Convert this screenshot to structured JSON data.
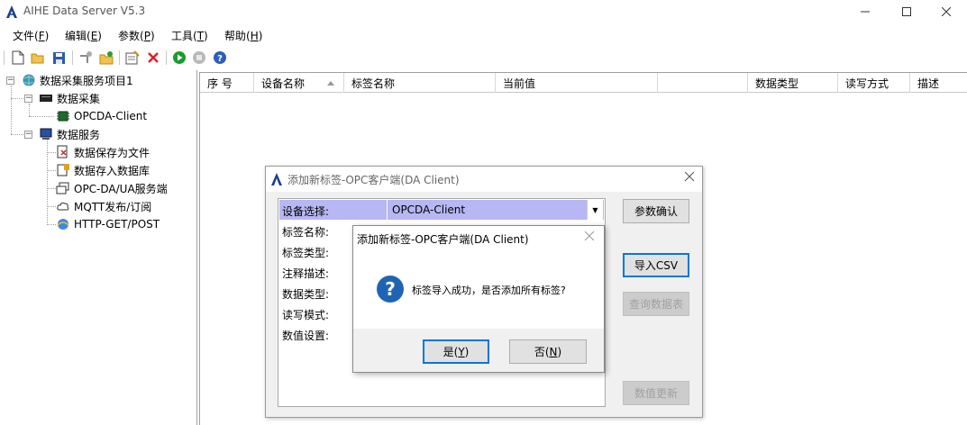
{
  "window": {
    "title": "AIHE Data Server V5.3"
  },
  "menu": [
    {
      "label": "文件(",
      "key": "F",
      "end": ")"
    },
    {
      "label": "编辑(",
      "key": "E",
      "end": ")"
    },
    {
      "label": "参数(",
      "key": "P",
      "end": ")"
    },
    {
      "label": "工具(",
      "key": "T",
      "end": ")"
    },
    {
      "label": "帮助(",
      "key": "H",
      "end": ")"
    }
  ],
  "tree": {
    "root": "数据采集服务项目1",
    "collect": "数据采集",
    "opcda_client": "OPCDA-Client",
    "service": "数据服务",
    "save_file": "数据保存为文件",
    "save_db": "数据存入数据库",
    "opc_server": "OPC-DA/UA服务端",
    "mqtt": "MQTT发布/订阅",
    "http": "HTTP-GET/POST"
  },
  "grid": {
    "columns": [
      "序 号",
      "设备名称",
      "标签名称",
      "当前值",
      "数据类型",
      "读写方式",
      "描述"
    ]
  },
  "add_dialog": {
    "title": "添加新标签-OPC客户端(DA Client)",
    "labels": [
      "设备选择:",
      "标签名称:",
      "标签类型:",
      "注释描述:",
      "数据类型:",
      "读写模式:",
      "数值设置:"
    ],
    "device_value": "OPCDA-Client",
    "btn_confirm": "参数确认",
    "btn_import": "导入CSV",
    "btn_query": "查询数据表",
    "btn_update": "数值更新"
  },
  "msgbox": {
    "title": "添加新标签-OPC客户端(DA Client)",
    "message": "标签导入成功，是否添加所有标签?",
    "yes": "是(",
    "yes_key": "Y",
    "no": "否(",
    "no_key": "N",
    "close_paren": ")"
  },
  "colors": {
    "accent": "#0078d7",
    "selection": "#b7b7f4",
    "question": "#1f64b4"
  }
}
